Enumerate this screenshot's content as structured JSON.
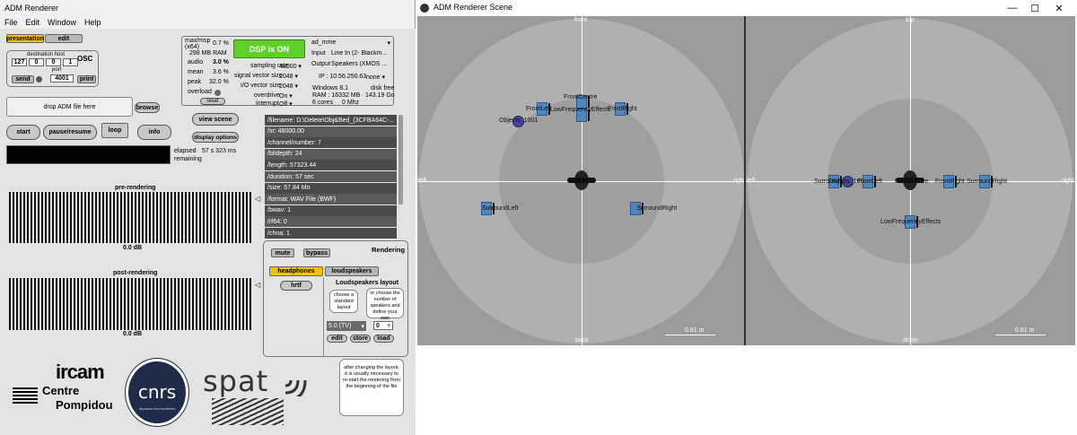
{
  "main_window": {
    "title": "ADM Renderer",
    "menu": [
      "File",
      "Edit",
      "Window",
      "Help"
    ],
    "mode_tabs": {
      "presentation": "presentation",
      "edit": "edit"
    },
    "osc": {
      "title": "OSC",
      "dest_label": "destination host",
      "ip": [
        "127",
        "0",
        "0",
        "1"
      ],
      "port_label": "port",
      "port": "4001",
      "send": "send",
      "print": "print"
    },
    "dsp": {
      "maxmsp_label": "max/msp",
      "arch": "(x64)",
      "cpu_pct": "0.7 %",
      "ram": "298 MB RAM",
      "audio_label": "audio",
      "audio_val": "3.0 %",
      "mean_label": "mean",
      "mean_val": "3.6 %",
      "peak_label": "peak",
      "peak_val": "32.0 %",
      "overload_label": "overload",
      "reset": "reset",
      "dsp_button": "DSP is ON",
      "sr_label": "sampling rate",
      "sr_val": "48000",
      "svs_label": "signal vector size",
      "svs_val": "2048",
      "io_label": "I/O vector size",
      "io_val": "2048",
      "overdrive_label": "overdrive",
      "overdrive_val": "On",
      "interrupt_label": "interrupt",
      "interrupt_val": "Off",
      "driver": "ad_mme",
      "input_label": "Input",
      "input_val": "Line In (2- Blackm...",
      "output_label": "Output",
      "output_val": "Speakers (XMOS ...",
      "ip": "IP : 10.56.250.63",
      "net": "none",
      "os": "Windows 8.1",
      "ram_total": "RAM : 16332 MB",
      "cores": "6 cores",
      "mhz": "0 Mhz",
      "disk_label": "disk free",
      "disk_val": "143.19 Go"
    },
    "drop_label": "drop ADM file here",
    "browse": "browse",
    "view_scene": "view scene",
    "display_options": "display options",
    "start": "start",
    "pause": "pause/resume",
    "loop": "loop",
    "info": "info",
    "elapsed_label": "elapsed",
    "elapsed_val": "57 s 323 ms",
    "remaining_label": "remaining",
    "file_info": [
      "/filename: D:\\Delete\\Obj&Bed_{3CFBA64C-...",
      "/sr: 48000.00",
      "/channel/number: 7",
      "/bitdepth: 24",
      "/length: 57323.44",
      "/duration: 57 sec",
      "/size: 57.84 Mo",
      "/format: WAV File (BWF)",
      "/bwav: 1",
      "/rf64: 0",
      "/chna: 1"
    ],
    "pre_label": "pre-rendering",
    "pre_db": "0.0 dB",
    "post_label": "post-rendering",
    "post_db": "0.0 dB",
    "rendering": {
      "title": "Rendering",
      "mute": "mute",
      "bypass": "bypass",
      "headphones": "headphones",
      "loudspeakers": "loudspeakers",
      "hrtf": "hrtf",
      "layout_title": "Loudspeakers layout",
      "tip_standard": "choose a standard layout",
      "tip_number": "or choose the number of speakers and define your own",
      "layout_val": "5.0 (TV)",
      "num_val": "0",
      "edit": "edit",
      "store": "store",
      "load": "load",
      "tip_restart": "after changing the layout, it is usually necessary to re-start the rendering from the beginning of the file"
    },
    "logos": {
      "ircam": "ircam",
      "centre": "Centre",
      "pompidou": "Pompidou",
      "cnrs": "cnrs",
      "cnrs_sub": "dépasser les frontières",
      "spat": "spat"
    }
  },
  "scene_window": {
    "title": "ADM Renderer Scene",
    "controls": {
      "minimize": "—",
      "maximize": "☐",
      "close": "✕"
    },
    "top_view": {
      "front": "front",
      "back": "back",
      "left": "left",
      "right": "right",
      "scale": "0.81 m",
      "speakers": [
        "FrontLeft",
        "FrontCentre",
        "LowFrequencyEffects",
        "FrontRight",
        "SurroundLeft",
        "SurroundRight"
      ],
      "object": "Objects_1001"
    },
    "side_view": {
      "top": "top",
      "down": "down",
      "left": "left",
      "right": "right",
      "scale": "0.81 m",
      "labels": [
        "SurroundLeft",
        "Objects_1001",
        "FrontLeft",
        "FrontCentre",
        "FrontRight",
        "SurroundRight",
        "LowFrequencyEffects"
      ]
    }
  }
}
